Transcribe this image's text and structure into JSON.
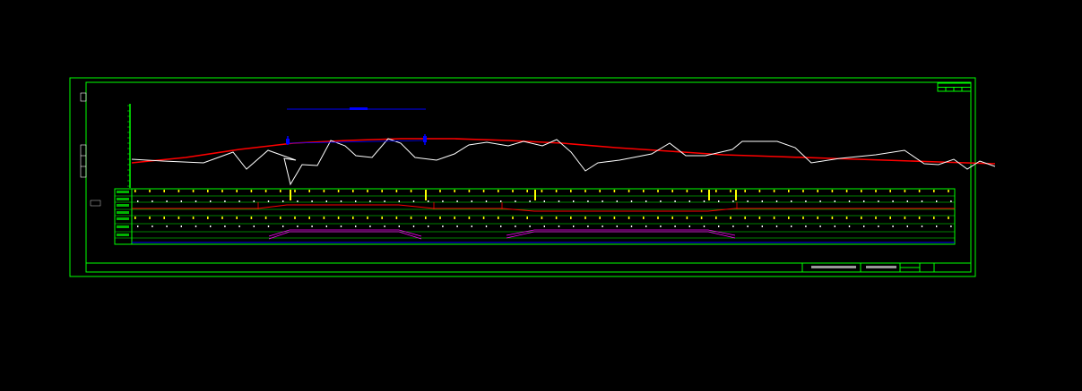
{
  "colors": {
    "background": "#000000",
    "frame": "#00ff00",
    "ground_line": "#ffffff",
    "design_line": "#ff0000",
    "annotation": "#0000ff",
    "marker": "#ffff00",
    "table_line": "#00ff00",
    "band": "#ff00ff"
  },
  "drawing": {
    "scale_label": "",
    "title_block_text": "",
    "sheet_label": ""
  },
  "profile": {
    "ground_points": [
      [
        0,
        66
      ],
      [
        35,
        68
      ],
      [
        80,
        70
      ],
      [
        113,
        58
      ],
      [
        128,
        77
      ],
      [
        152,
        56
      ],
      [
        183,
        67
      ],
      [
        170,
        65
      ],
      [
        177,
        94
      ],
      [
        190,
        72
      ],
      [
        207,
        73
      ],
      [
        222,
        45
      ],
      [
        238,
        51
      ],
      [
        250,
        62
      ],
      [
        268,
        64
      ],
      [
        286,
        43
      ],
      [
        300,
        48
      ],
      [
        316,
        64
      ],
      [
        340,
        67
      ],
      [
        360,
        60
      ],
      [
        376,
        50
      ],
      [
        396,
        47
      ],
      [
        420,
        51
      ],
      [
        437,
        46
      ],
      [
        458,
        51
      ],
      [
        474,
        44
      ],
      [
        490,
        58
      ],
      [
        506,
        79
      ],
      [
        520,
        70
      ],
      [
        544,
        67
      ],
      [
        580,
        60
      ],
      [
        600,
        48
      ],
      [
        618,
        62
      ],
      [
        640,
        62
      ],
      [
        670,
        55
      ],
      [
        681,
        46
      ],
      [
        720,
        46
      ],
      [
        740,
        53
      ],
      [
        758,
        70
      ],
      [
        790,
        65
      ],
      [
        830,
        61
      ],
      [
        862,
        56
      ],
      [
        884,
        71
      ],
      [
        900,
        72
      ],
      [
        917,
        66
      ],
      [
        932,
        77
      ],
      [
        946,
        68
      ],
      [
        963,
        74
      ]
    ],
    "design_points": [
      [
        0,
        70
      ],
      [
        60,
        64
      ],
      [
        120,
        55
      ],
      [
        180,
        48
      ],
      [
        240,
        45
      ],
      [
        300,
        43
      ],
      [
        360,
        43
      ],
      [
        420,
        45
      ],
      [
        480,
        48
      ],
      [
        540,
        53
      ],
      [
        600,
        57
      ],
      [
        660,
        61
      ],
      [
        720,
        63
      ],
      [
        780,
        65
      ],
      [
        840,
        67
      ],
      [
        900,
        69
      ],
      [
        963,
        71
      ]
    ]
  },
  "table": {
    "row_count": 7
  }
}
